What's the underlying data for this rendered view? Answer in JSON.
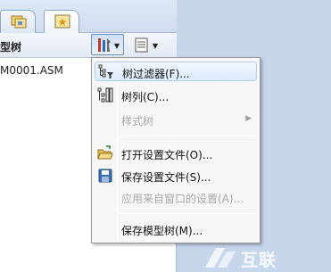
{
  "panel": {
    "header_title": "型树",
    "tree_root": "M0001.ASM"
  },
  "menu": {
    "items": [
      {
        "label": "树过滤器(F)...",
        "icon": "tree-filter-icon",
        "highlighted": true,
        "enabled": true
      },
      {
        "label": "树列(C)...",
        "icon": "tree-columns-icon",
        "enabled": true
      },
      {
        "label": "样式树",
        "icon": "",
        "enabled": false,
        "submenu": true
      },
      {
        "label": "打开设置文件(O)...",
        "icon": "open-folder-icon",
        "enabled": true
      },
      {
        "label": "保存设置文件(S)...",
        "icon": "save-disk-icon",
        "enabled": true
      },
      {
        "label": "应用来自窗口的设置(A)...",
        "icon": "",
        "enabled": false
      },
      {
        "label": "保存模型树(M)...",
        "icon": "",
        "enabled": true
      }
    ]
  },
  "watermark": {
    "text": "互联"
  },
  "colors": {
    "background": "#c6d7ec",
    "highlight": "#dcebfc",
    "disabled_text": "#a7a7a7"
  }
}
